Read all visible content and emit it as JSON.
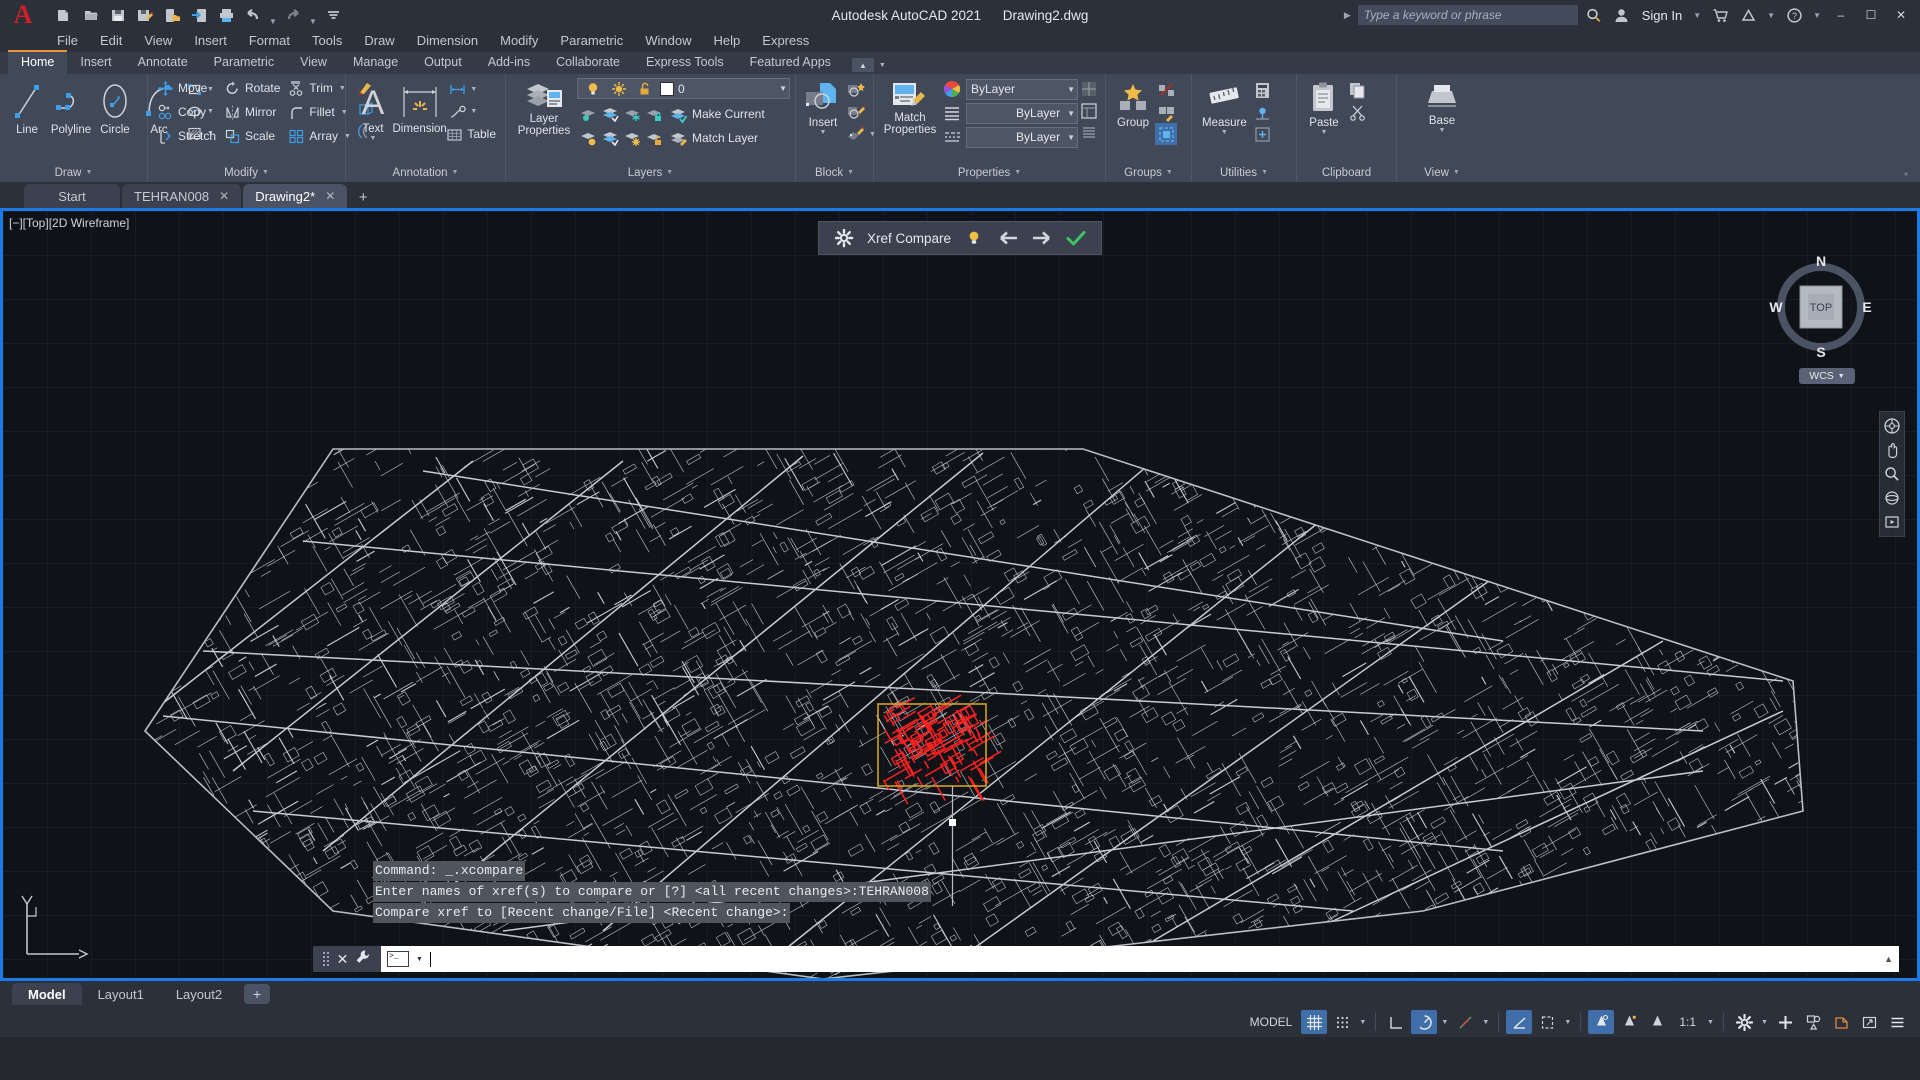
{
  "titlebar": {
    "app_title": "Autodesk AutoCAD 2021",
    "document": "Drawing2.dwg",
    "quick_access": [
      {
        "name": "new-icon",
        "label": "New"
      },
      {
        "name": "open-icon",
        "label": "Open"
      },
      {
        "name": "save-icon",
        "label": "Save"
      },
      {
        "name": "save-as-icon",
        "label": "Save As"
      },
      {
        "name": "save-to-web-icon",
        "label": "Save to Web & Mobile"
      },
      {
        "name": "open-from-web-icon",
        "label": "Open from Web & Mobile"
      },
      {
        "name": "plot-icon",
        "label": "Plot"
      },
      {
        "name": "undo-icon",
        "label": "Undo"
      },
      {
        "name": "redo-icon",
        "label": "Redo"
      },
      {
        "name": "customize-qat-icon",
        "label": "Customize Quick Access Toolbar"
      }
    ],
    "search_placeholder": "Type a keyword or phrase",
    "sign_in": "Sign In",
    "right_icons": [
      "search-icon",
      "user-icon",
      "cart-icon",
      "autodesk-app-icon",
      "help-icon"
    ],
    "window_buttons": [
      "minimize",
      "restore",
      "close"
    ]
  },
  "menubar": {
    "items": [
      "File",
      "Edit",
      "View",
      "Insert",
      "Format",
      "Tools",
      "Draw",
      "Dimension",
      "Modify",
      "Parametric",
      "Window",
      "Help",
      "Express"
    ]
  },
  "ribbon": {
    "tabs": [
      "Home",
      "Insert",
      "Annotate",
      "Parametric",
      "View",
      "Manage",
      "Output",
      "Add-ins",
      "Collaborate",
      "Express Tools",
      "Featured Apps"
    ],
    "active_tab": "Home",
    "panels": {
      "draw": {
        "title": "Draw",
        "big_buttons": [
          {
            "name": "line-tool",
            "label": "Line"
          },
          {
            "name": "polyline-tool",
            "label": "Polyline"
          },
          {
            "name": "circle-tool",
            "label": "Circle"
          },
          {
            "name": "arc-tool",
            "label": "Arc"
          }
        ],
        "small_buttons": [
          {
            "name": "rectangle-tool",
            "label": "Rectangle"
          },
          {
            "name": "ellipse-tool",
            "label": "Ellipse"
          },
          {
            "name": "hatch-tool",
            "label": "Hatch"
          }
        ]
      },
      "modify": {
        "title": "Modify",
        "items": [
          {
            "name": "move-tool",
            "label": "Move"
          },
          {
            "name": "rotate-tool",
            "label": "Rotate"
          },
          {
            "name": "trim-tool",
            "label": "Trim"
          },
          {
            "name": "copy-tool",
            "label": "Copy"
          },
          {
            "name": "mirror-tool",
            "label": "Mirror"
          },
          {
            "name": "fillet-tool",
            "label": "Fillet"
          },
          {
            "name": "stretch-tool",
            "label": "Stretch"
          },
          {
            "name": "scale-tool",
            "label": "Scale"
          },
          {
            "name": "array-tool",
            "label": "Array"
          }
        ],
        "extra_icons": [
          "erase-icon",
          "explode-icon",
          "offset-icon"
        ]
      },
      "annotation": {
        "title": "Annotation",
        "text": "Text",
        "dimension": "Dimension",
        "table": "Table",
        "extra_icons": [
          "linear-dimension-icon",
          "leader-icon"
        ]
      },
      "layers": {
        "title": "Layers",
        "layer_properties": "Layer\nProperties",
        "layer_properties_l1": "Layer",
        "layer_properties_l2": "Properties",
        "current_layer": "0",
        "make_current": "Make Current",
        "match_layer": "Match Layer",
        "state_icons": [
          "layer-on-icon",
          "layer-freeze-icon",
          "layer-lock-icon",
          "layer-color-swatch"
        ],
        "row1_icons": [
          "layer-isolate-icon",
          "layer-unisolate-icon",
          "layer-freeze-obj-icon",
          "layer-lock-obj-icon"
        ],
        "row2_icons": [
          "layer-off-icon",
          "layer-turn-all-on-icon",
          "layer-thaw-all-icon",
          "layer-unlock-icon"
        ]
      },
      "block": {
        "title": "Block",
        "insert": "Insert",
        "icons": [
          "create-block-icon",
          "edit-block-icon",
          "edit-attribute-icon"
        ]
      },
      "properties": {
        "title": "Properties",
        "match_properties_l1": "Match",
        "match_properties_l2": "Properties",
        "color": "ByLayer",
        "linewidth": "ByLayer",
        "linetype": "ByLayer",
        "icons": [
          "color-wheel-icon",
          "linetype-icon",
          "lineweight-icon",
          "transparency-icon"
        ]
      },
      "groups": {
        "title": "Groups",
        "group": "Group",
        "icons": [
          "ungroup-icon",
          "group-edit-icon"
        ]
      },
      "utilities": {
        "title": "Utilities",
        "measure": "Measure",
        "icons": [
          "quick-calc-icon",
          "id-point-icon",
          "point-style-icon"
        ]
      },
      "clipboard": {
        "title": "Clipboard",
        "paste": "Paste",
        "icons": [
          "copy-clip-icon",
          "cut-clip-icon"
        ]
      },
      "view": {
        "title": "View",
        "base": "Base"
      }
    }
  },
  "file_tabs": {
    "tabs": [
      {
        "label": "Start",
        "closable": false,
        "active": false
      },
      {
        "label": "TEHRAN008",
        "closable": true,
        "active": false
      },
      {
        "label": "Drawing2*",
        "closable": true,
        "active": true
      }
    ],
    "add_label": "+"
  },
  "viewport": {
    "label": "[−][Top][2D Wireframe]",
    "background_color": "#0f1318",
    "border_color": "#1a7ae8",
    "xref_compare": {
      "title": "Xref Compare",
      "buttons": [
        "settings-gear-icon",
        "lightbulb-icon",
        "previous-change-icon",
        "next-change-icon",
        "accept-checkmark-icon"
      ]
    },
    "viewcube": {
      "face": "TOP",
      "north": "N",
      "east": "E",
      "south": "S",
      "west": "W",
      "wcs_label": "WCS"
    },
    "nav_icons": [
      "steering-wheel-icon",
      "pan-icon",
      "zoom-extents-icon",
      "orbit-icon",
      "showmotion-icon"
    ],
    "drawing_colors": {
      "lines": "#c8ccd2",
      "highlight": "#ff2020",
      "boundary": "#d2a01e",
      "grid": "#222831"
    }
  },
  "command_history": [
    "Command: _.xcompare",
    "Enter names of xref(s) to compare or [?] <all recent changes>:TEHRAN008",
    "Compare xref to [Recent change/File] <Recent change>:"
  ],
  "command_line": {
    "value": "",
    "prompt_icon": "command-prompt-icon",
    "tools": [
      "command-grip",
      "close-icon",
      "customize-wrench-icon"
    ],
    "expand_icon": "chevron-up-icon"
  },
  "layout_tabs": {
    "tabs": [
      {
        "label": "Model",
        "active": true
      },
      {
        "label": "Layout1",
        "active": false
      },
      {
        "label": "Layout2",
        "active": false
      }
    ],
    "add_label": "+"
  },
  "statusbar": {
    "model_label": "MODEL",
    "scale": "1:1",
    "toggles": [
      {
        "name": "grid-display-toggle",
        "icon": "grid-icon",
        "active": true
      },
      {
        "name": "snap-mode-toggle",
        "icon": "snap-icon",
        "active": false
      },
      {
        "name": "ortho-mode-toggle",
        "icon": "ortho-icon",
        "active": false
      },
      {
        "name": "polar-tracking-toggle",
        "icon": "polar-icon",
        "active": true
      },
      {
        "name": "object-snap-tracking-toggle",
        "icon": "osnap-tracking-icon",
        "active": false
      },
      {
        "name": "object-snap-toggle",
        "icon": "osnap-icon",
        "active": true
      },
      {
        "name": "lineweight-toggle",
        "icon": "lineweight-icon",
        "active": false
      },
      {
        "name": "transparency-toggle",
        "icon": "transparency-icon",
        "active": true
      },
      {
        "name": "selection-cycling-toggle",
        "icon": "selection-cycling-icon",
        "active": false
      },
      {
        "name": "annotation-monitor-toggle",
        "icon": "annotation-monitor-icon",
        "active": false
      },
      {
        "name": "workspace-switching",
        "icon": "gear-icon",
        "active": false
      },
      {
        "name": "hardware-acceleration",
        "icon": "plus-icon",
        "active": false
      },
      {
        "name": "isolate-objects",
        "icon": "isolate-icon",
        "active": false
      },
      {
        "name": "clean-screen",
        "icon": "clean-screen-icon",
        "active": false
      },
      {
        "name": "fullscreen-toggle",
        "icon": "fullscreen-icon",
        "active": false
      },
      {
        "name": "customization-menu",
        "icon": "hamburger-icon",
        "active": false
      }
    ]
  }
}
